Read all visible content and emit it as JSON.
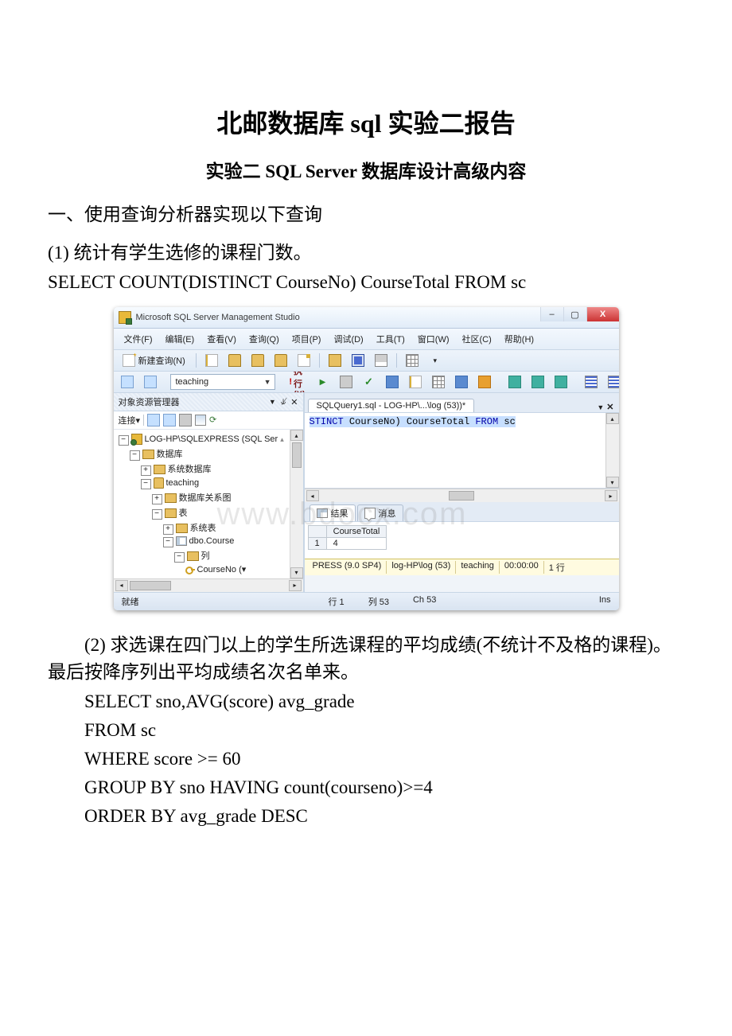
{
  "title": "北邮数据库 sql 实验二报告",
  "subtitle": "实验二 SQL Server 数据库设计高级内容",
  "section1_head": "一、使用查询分析器实现以下查询",
  "q1_text": "(1) 统计有学生选修的课程门数。",
  "q1_sql": "SELECT COUNT(DISTINCT CourseNo) CourseTotal FROM sc",
  "q2_text": "(2) 求选课在四门以上的学生所选课程的平均成绩(不统计不及格的课程)。最后按降序列出平均成绩名次名单来。",
  "q2_sql_lines": {
    "l1": "SELECT sno,AVG(score) avg_grade",
    "l2": "FROM sc",
    "l3": "WHERE score >= 60",
    "l4": "GROUP BY sno HAVING count(courseno)>=4",
    "l5": "ORDER BY avg_grade DESC"
  },
  "ssms": {
    "window_title": "Microsoft SQL Server Management Studio",
    "minimize": "–",
    "maximize": "▢",
    "close": "X",
    "menu": {
      "file": "文件(F)",
      "edit": "编辑(E)",
      "view": "查看(V)",
      "query": "查询(Q)",
      "project": "项目(P)",
      "debug": "调试(D)",
      "tools": "工具(T)",
      "window": "窗口(W)",
      "community": "社区(C)",
      "help": "帮助(H)"
    },
    "toolbar": {
      "new_query": "新建查询(N)",
      "database": "teaching",
      "execute": "执行(X)"
    },
    "object_explorer": {
      "title": "对象资源管理器",
      "pin": "▾ ⤢ ✕",
      "connect": "连接▾",
      "server": "LOG-HP\\SQLEXPRESS (SQL Ser",
      "databases": "数据库",
      "sys_db": "系统数据库",
      "teaching": "teaching",
      "db_diagram": "数据库关系图",
      "tables": "表",
      "sys_tables": "系统表",
      "dbo_course": "dbo.Course",
      "columns": "列",
      "courseno": "CourseNo (▾"
    },
    "editor": {
      "tab_title": "SQLQuery1.sql - LOG-HP\\...\\log (53))*",
      "code_kw_stinct": "STINCT",
      "code_txt1": " CourseNo",
      "code_txt2": " CourseTotal ",
      "code_kw_from": "FROM",
      "code_txt3": " sc",
      "scroll_marker": "⬍"
    },
    "results": {
      "tab_results": "结果",
      "tab_messages": "消息",
      "col_header": "CourseTotal",
      "row1": "1",
      "value": "4"
    },
    "status_server": {
      "server_info": "PRESS (9.0 SP4)",
      "login": "log-HP\\log (53)",
      "db": "teaching",
      "time": "00:00:00",
      "rows": "1 行"
    },
    "statusbar": {
      "ready": "就绪",
      "line": "行 1",
      "col": "列 53",
      "ch": "Ch 53",
      "ins": "Ins"
    }
  }
}
